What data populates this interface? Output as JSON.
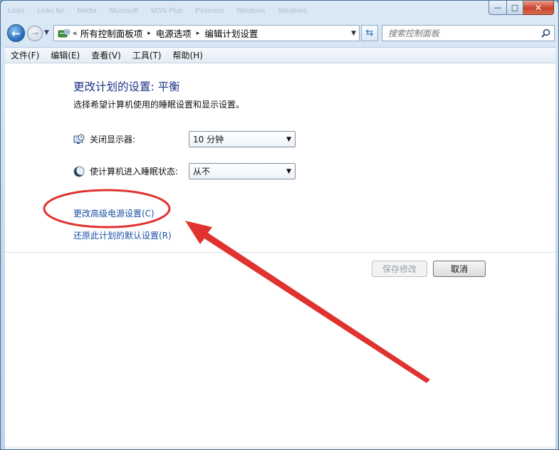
{
  "window": {
    "background_tabs": [
      "Links",
      "Links for",
      "Media",
      "Microsoft",
      "MSN Plus",
      "Pinterest",
      "Windows",
      "Windows"
    ],
    "caption": {
      "min": "—",
      "max": "□",
      "close": "✕"
    }
  },
  "address": {
    "overflow": "«",
    "parts": [
      "所有控制面板项",
      "电源选项",
      "编辑计划设置"
    ],
    "separator": "▸"
  },
  "search": {
    "placeholder": "搜索控制面板"
  },
  "menu": [
    "文件(F)",
    "编辑(E)",
    "查看(V)",
    "工具(T)",
    "帮助(H)"
  ],
  "page": {
    "title": "更改计划的设置: 平衡",
    "description": "选择希望计算机使用的睡眠设置和显示设置。",
    "display_off": {
      "label": "关闭显示器:",
      "value": "10 分钟"
    },
    "sleep": {
      "label": "使计算机进入睡眠状态:",
      "value": "从不"
    },
    "link_advanced": "更改高级电源设置(C)",
    "link_restore": "还原此计划的默认设置(R)",
    "save_label": "保存修改",
    "cancel_label": "取消"
  },
  "colors": {
    "annotation": "#e0332f",
    "link": "#1a4fa3",
    "title": "#1e3287"
  }
}
